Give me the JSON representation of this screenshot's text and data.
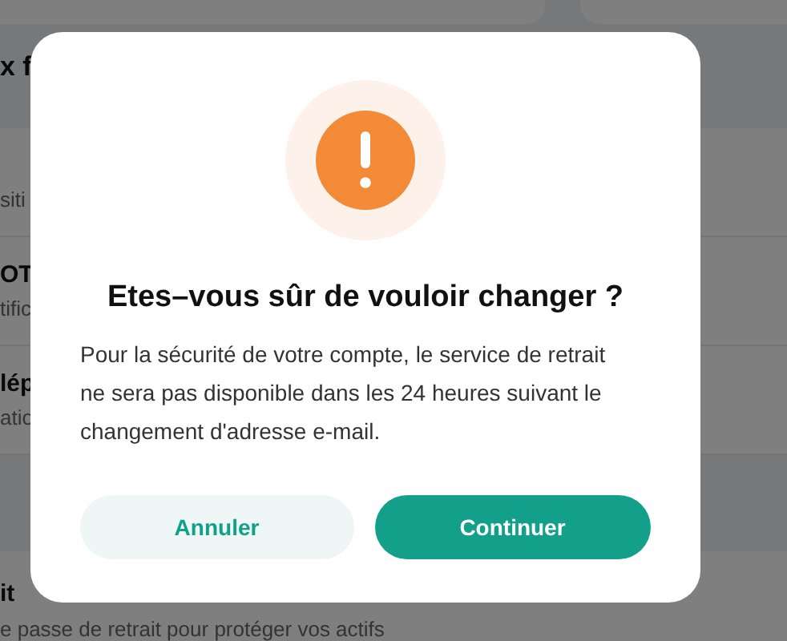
{
  "background": {
    "header": "x f",
    "rows": [
      {
        "subtitle": "siti"
      },
      {
        "title": "OT",
        "subtitle": "tific"
      },
      {
        "title": "lép",
        "subtitle": "atio"
      }
    ],
    "footer_row": {
      "title": "it",
      "subtitle": "e passe de retrait pour protéger vos actifs"
    }
  },
  "dialog": {
    "title": "Etes–vous sûr de vouloir changer ?",
    "message": "Pour la sécurité de votre compte, le service de retrait ne sera pas disponible dans les 24 heures suivant le changement d'adresse e-mail.",
    "buttons": [
      {
        "label": "Annuler",
        "kind": "secondary"
      },
      {
        "label": "Continuer",
        "kind": "primary"
      }
    ]
  }
}
